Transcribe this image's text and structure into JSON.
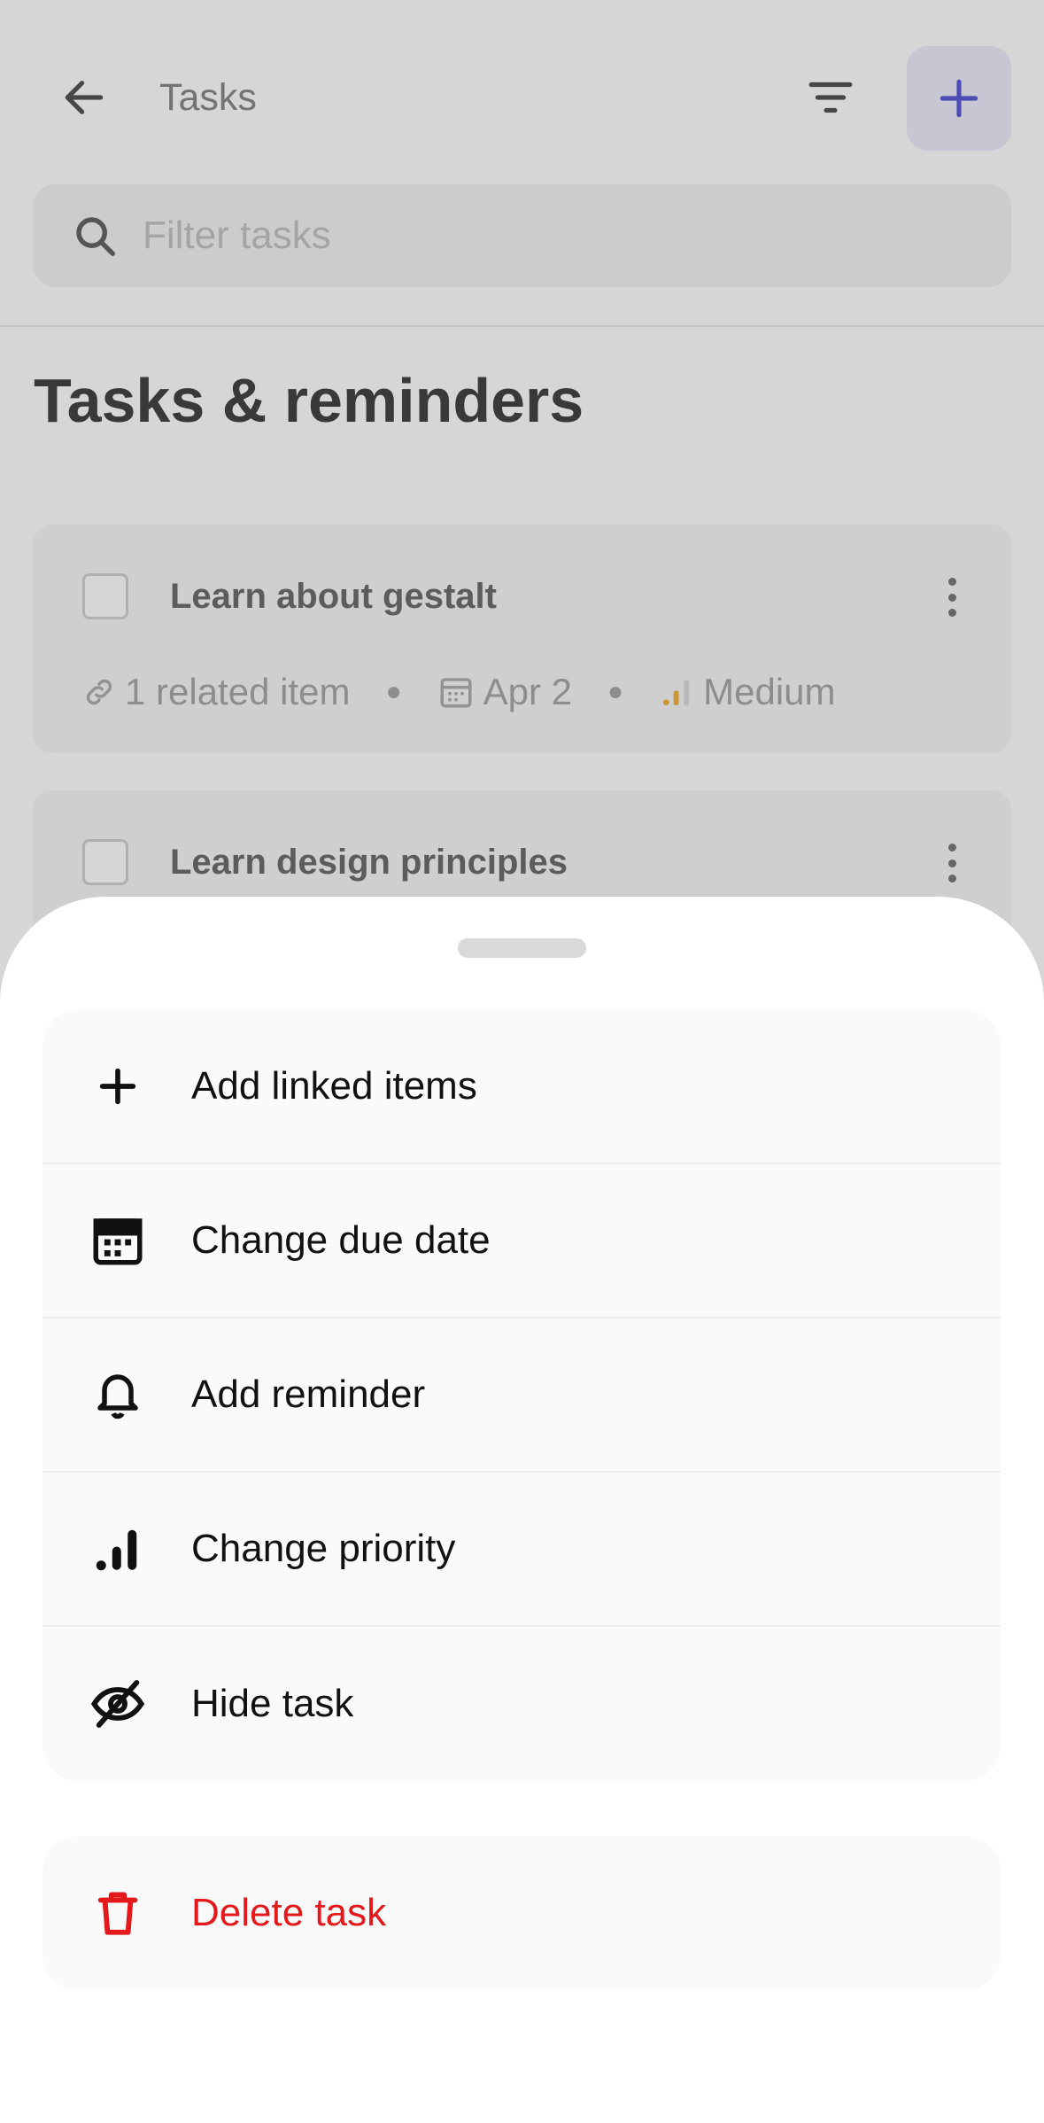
{
  "header": {
    "title": "Tasks",
    "search_placeholder": "Filter tasks"
  },
  "page": {
    "title": "Tasks & reminders"
  },
  "tasks": [
    {
      "title": "Learn about gestalt",
      "related": "1 related item",
      "due": "Apr 2",
      "priority": "Medium"
    },
    {
      "title": "Learn design principles"
    }
  ],
  "sheet": {
    "items": [
      {
        "label": "Add linked items",
        "icon": "plus-icon"
      },
      {
        "label": "Change due date",
        "icon": "calendar-icon"
      },
      {
        "label": "Add reminder",
        "icon": "bell-icon"
      },
      {
        "label": "Change priority",
        "icon": "priority-bars-icon"
      },
      {
        "label": "Hide task",
        "icon": "eye-off-icon"
      }
    ],
    "delete": {
      "label": "Delete task",
      "icon": "trash-icon"
    }
  },
  "colors": {
    "accent": "#5b5bd6",
    "danger": "#e3191b",
    "priority_medium": "#f2b33d"
  }
}
